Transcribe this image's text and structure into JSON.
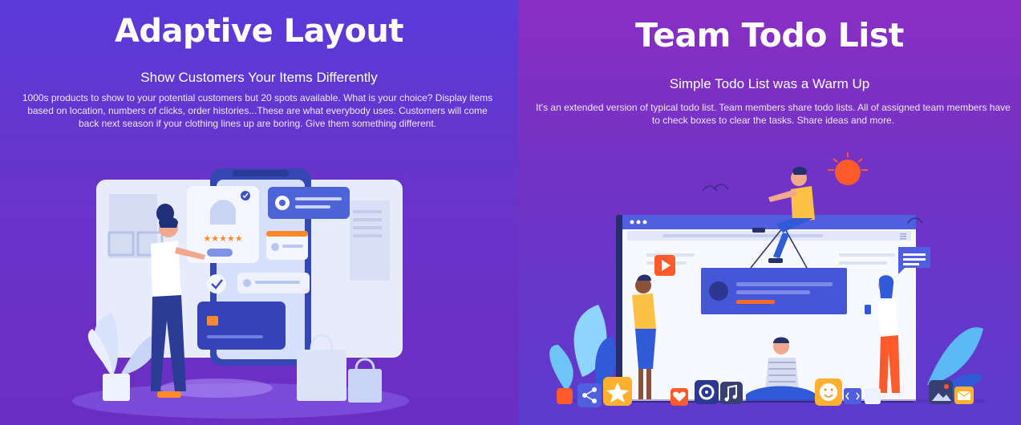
{
  "left_panel": {
    "title": "Adaptive Layout",
    "subtitle": "Show Customers Your Items Differently",
    "description": "1000s products to show to your potential customers but 20 spots available. What is your choice? Display items based on location, numbers of clicks, order histories...These are what everybody uses. Customers will come back next season if your clothing lines up are boring. Give them something different.",
    "rating_stars": "★★★★★"
  },
  "right_panel": {
    "title": "Team Todo List",
    "subtitle": "Simple Todo List was a Warm Up",
    "description": "It's an extended version of typical todo list. Team members share todo lists. All of assigned team members have to check boxes to clear the tasks. Share ideas and more."
  },
  "icons": [
    "settings-icon",
    "check-icon",
    "star-icon",
    "share-icon",
    "play-icon",
    "music-icon",
    "smile-icon",
    "heart-icon",
    "mail-icon",
    "image-icon",
    "code-icon",
    "menu-icon",
    "sun-icon"
  ],
  "colors": {
    "left_bg": "#5a3ad8",
    "right_bg": "#8a2ec3",
    "accent_orange": "#ff6a2b",
    "card_blue": "#3f4fc8"
  }
}
